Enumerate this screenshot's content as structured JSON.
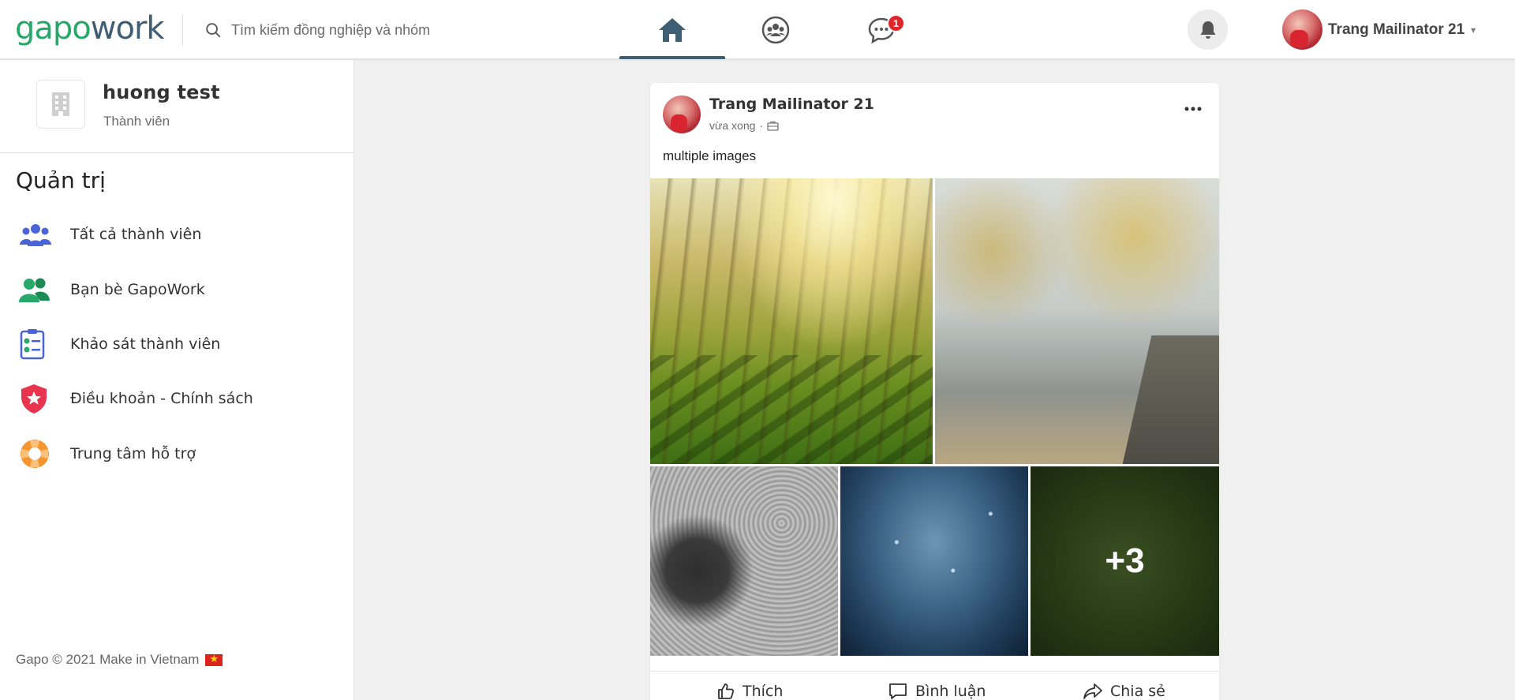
{
  "header": {
    "logo_part1": "gapo",
    "logo_part2": "work",
    "search_placeholder": "Tìm kiếm đồng nghiệp và nhóm",
    "nav_tabs": [
      {
        "id": "home",
        "icon": "home-icon",
        "active": true
      },
      {
        "id": "groups",
        "icon": "groups-icon",
        "active": false
      },
      {
        "id": "messages",
        "icon": "chat-icon",
        "active": false,
        "badge": "1"
      }
    ],
    "user_name": "Trang Mailinator 21",
    "caret": "▾"
  },
  "sidebar": {
    "org_name": "huong test",
    "org_role": "Thành viên",
    "section_title": "Quản trị",
    "items": [
      {
        "label": "Tất cả thành viên",
        "icon": "members-icon",
        "color": "#4a63d8"
      },
      {
        "label": "Bạn bè GapoWork",
        "icon": "friends-icon",
        "color": "#27a869"
      },
      {
        "label": "Khảo sát thành viên",
        "icon": "survey-icon",
        "color": "#4a63d8"
      },
      {
        "label": "Điều khoản - Chính sách",
        "icon": "policy-icon",
        "color": "#e8344e"
      },
      {
        "label": "Trung tâm hỗ trợ",
        "icon": "support-icon",
        "color": "#f5952f"
      }
    ],
    "footer": "Gapo © 2021 Make in Vietnam"
  },
  "post": {
    "author": "Trang Mailinator 21",
    "time": "vừa xong",
    "privacy_icon": "work-icon",
    "text": "multiple images",
    "extra_images": "+3",
    "actions": {
      "like": "Thích",
      "comment": "Bình luận",
      "share": "Chia sẻ"
    }
  },
  "colors": {
    "brand_green": "#27a869",
    "brand_dark": "#3f5e73",
    "badge_red": "#e0252b"
  }
}
